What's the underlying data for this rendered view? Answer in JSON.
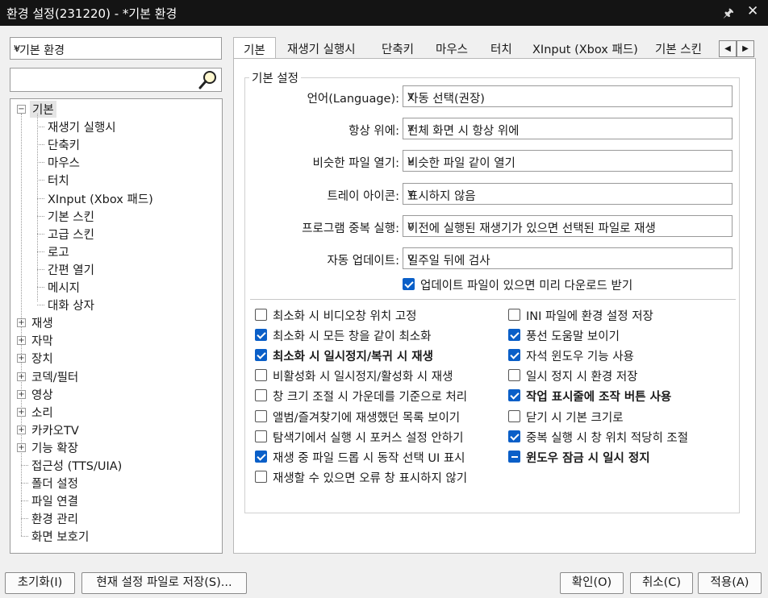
{
  "window": {
    "title": "환경 설정(231220) - *기본 환경",
    "pin_glyph": "🖈",
    "close_glyph": "✕"
  },
  "preset": {
    "value": "*기본 환경"
  },
  "search": {
    "value": "",
    "placeholder": ""
  },
  "tree": {
    "root_label": "기본",
    "children": [
      "재생기 실행시",
      "단축키",
      "마우스",
      "터치",
      "XInput (Xbox 패드)",
      "기본 스킨",
      "고급 스킨",
      "로고",
      "간편 열기",
      "메시지",
      "대화 상자"
    ],
    "collapsed": [
      "재생",
      "자막",
      "장치",
      "코덱/필터",
      "영상",
      "소리",
      "카카오TV",
      "기능 확장"
    ],
    "leaves": [
      "접근성 (TTS/UIA)",
      "폴더 설정",
      "파일 연결",
      "환경 관리",
      "화면 보호기"
    ]
  },
  "tabs": [
    "기본",
    "재생기 실행시",
    "단축키",
    "마우스",
    "터치",
    "XInput (Xbox 패드)",
    "기본 스킨"
  ],
  "tab_scroll": {
    "left": "◀",
    "right": "▶"
  },
  "group": {
    "title": "기본 설정"
  },
  "settings": [
    {
      "label": "언어(Language):",
      "value": "자동 선택(권장)"
    },
    {
      "label": "항상 위에:",
      "value": "전체 화면 시 항상 위에"
    },
    {
      "label": "비슷한 파일 열기:",
      "value": "비슷한 파일 같이 열기"
    },
    {
      "label": "트레이 아이콘:",
      "value": "표시하지 않음"
    },
    {
      "label": "프로그램 중복 실행:",
      "value": "이전에 실행된 재생기가 있으면 선택된 파일로 재생"
    },
    {
      "label": "자동 업데이트:",
      "value": "일주일 뒤에 검사"
    }
  ],
  "update_check": {
    "label": "업데이트 파일이 있으면 미리 다운로드 받기",
    "state": "checked"
  },
  "left_checks": [
    {
      "label": "최소화 시 비디오창 위치 고정",
      "state": "unchecked"
    },
    {
      "label": "최소화 시 모든 창을 같이 최소화",
      "state": "checked"
    },
    {
      "label": "최소화 시 일시정지/복귀 시 재생",
      "state": "checked",
      "bold": true
    },
    {
      "label": "비활성화 시 일시정지/활성화 시 재생",
      "state": "unchecked"
    },
    {
      "label": "창 크기 조절 시 가운데를 기준으로 처리",
      "state": "unchecked"
    },
    {
      "label": "앨범/즐겨찾기에 재생했던 목록 보이기",
      "state": "unchecked"
    },
    {
      "label": "탐색기에서 실행 시 포커스 설정 안하기",
      "state": "unchecked"
    },
    {
      "label": "재생 중 파일 드롭 시 동작 선택 UI 표시",
      "state": "checked"
    },
    {
      "label": "재생할 수 있으면 오류 창 표시하지 않기",
      "state": "unchecked"
    }
  ],
  "right_checks": [
    {
      "label": "INI 파일에 환경 설정 저장",
      "state": "unchecked"
    },
    {
      "label": "풍선 도움말 보이기",
      "state": "checked"
    },
    {
      "label": "자석 윈도우 기능 사용",
      "state": "checked"
    },
    {
      "label": "일시 정지 시 환경 저장",
      "state": "unchecked"
    },
    {
      "label": "작업 표시줄에 조작 버튼 사용",
      "state": "checked",
      "bold": true
    },
    {
      "label": "닫기 시 기본 크기로",
      "state": "unchecked"
    },
    {
      "label": "중복 실행 시 창 위치 적당히 조절",
      "state": "checked"
    },
    {
      "label": "윈도우 잠금 시 일시 정지",
      "state": "indeterminate",
      "bold": true
    }
  ],
  "buttons": {
    "reset": "초기화(I)",
    "save_current": "현재 설정 파일로 저장(S)...",
    "ok": "확인(O)",
    "cancel": "취소(C)",
    "apply": "적용(A)"
  },
  "dropdown_glyph": "v",
  "colors": {
    "titlebar": "#141414",
    "check_accent": "#0a5fc8"
  }
}
